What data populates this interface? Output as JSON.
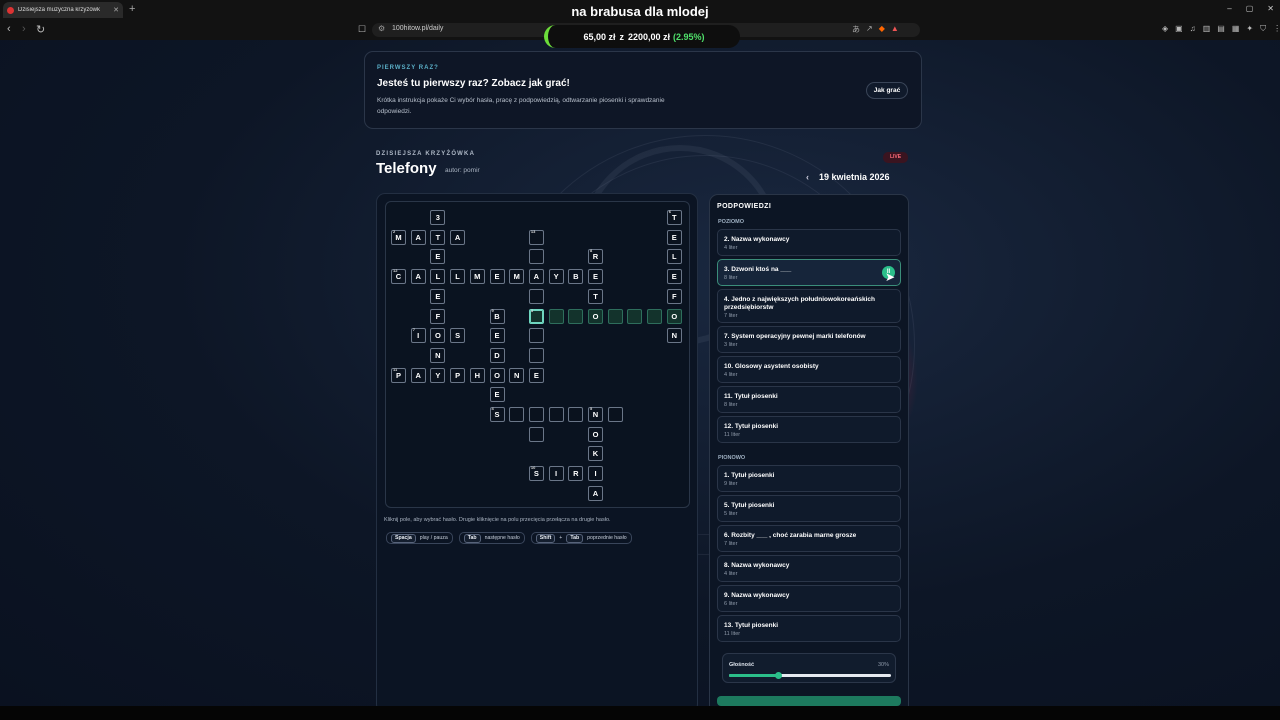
{
  "browser": {
    "tab_title": "Dzisiejsza muzyczna krzyżówk",
    "window_title": "na brabusa dla mlodej",
    "url": "100hitow.pl/daily",
    "new_tab": "+",
    "win_min": "–",
    "win_max": "▢",
    "win_close": "✕",
    "back": "‹",
    "forward": "›",
    "reload": "↻"
  },
  "donation": {
    "amount": "65,00 zł",
    "sep": "z",
    "goal": "2200,00 zł",
    "percent": "(2.95%)",
    "progress": 0.0295
  },
  "intro": {
    "eyebrow": "PIERWSZY RAZ?",
    "heading": "Jesteś tu pierwszy raz? Zobacz jak grać!",
    "body": "Krótka instrukcja pokaże Ci wybór hasła, pracę z podpowiedzią, odtwarzanie piosenki i sprawdzanie odpowiedzi.",
    "button": "Jak grać"
  },
  "crossword": {
    "eyebrow": "DZISIEJSZA KRZYŻÓWKA",
    "title": "Telefony",
    "author": "autor: pomir",
    "live": "LIVE",
    "date": "19 kwietnia 2026",
    "hint": "Kliknij pole, aby wybrać hasło. Drugie kliknięcie na polu przecięcia przełącza na drugie hasło.",
    "keys": [
      {
        "key1": "Spacja",
        "label": "play / pauza"
      },
      {
        "key1": "Tab",
        "label": "następne hasło"
      },
      {
        "key1": "Shift",
        "plus": "+",
        "key2": "Tab",
        "label": "poprzednie hasło"
      }
    ]
  },
  "clues": {
    "header": "PODPOWIEDZI",
    "across_label": "POZIOMO",
    "down_label": "PIONOWO",
    "across": [
      {
        "title": "2. Nazwa wykonawcy",
        "len": "4 liter"
      },
      {
        "title": "3. Dzwoni ktoś na ___",
        "len": "8 liter",
        "active": true,
        "play": "II"
      },
      {
        "title": "4. Jedno z największych południowokoreańskich",
        "title2": "przedsiębiorstw",
        "len": "7 liter"
      },
      {
        "title": "7. System operacyjny pewnej marki telefonów",
        "len": "3 liter"
      },
      {
        "title": "10. Glosowy asystent osobisty",
        "len": "4 liter"
      },
      {
        "title": "11. Tytuł piosenki",
        "len": "8 liter"
      },
      {
        "title": "12. Tytuł piosenki",
        "len": "11 liter"
      }
    ],
    "down": [
      {
        "title": "1. Tytuł piosenki",
        "len": "9 liter"
      },
      {
        "title": "5. Tytuł piosenki",
        "len": "5 liter"
      },
      {
        "title": "6. Rozbity ___ , choć zarabia marne grosze",
        "len": "7 liter"
      },
      {
        "title": "8. Nazwa wykonawcy",
        "len": "4 liter"
      },
      {
        "title": "9. Nazwa wykonawcy",
        "len": "6 liter"
      },
      {
        "title": "13. Tytuł piosenki",
        "len": "11 liter"
      }
    ]
  },
  "volume": {
    "label": "Głośność",
    "value": "30%",
    "level": 0.3
  },
  "colors": {
    "accent": "#2bbf8a",
    "live": "#ff6b7a",
    "donation_green": "#4fe06a"
  },
  "grid_cells": [
    {
      "r": 0,
      "c": 2,
      "ch": "3"
    },
    {
      "r": 0,
      "c": 14,
      "ch": "T",
      "n": "6"
    },
    {
      "r": 1,
      "c": 0,
      "ch": "M",
      "n": "2"
    },
    {
      "r": 1,
      "c": 1,
      "ch": "A"
    },
    {
      "r": 1,
      "c": 2,
      "ch": "T"
    },
    {
      "r": 1,
      "c": 3,
      "ch": "A"
    },
    {
      "r": 1,
      "c": 7,
      "ch": "",
      "n": "13"
    },
    {
      "r": 1,
      "c": 14,
      "ch": "E"
    },
    {
      "r": 2,
      "c": 2,
      "ch": "E"
    },
    {
      "r": 2,
      "c": 7,
      "ch": ""
    },
    {
      "r": 2,
      "c": 10,
      "ch": "R",
      "n": "8"
    },
    {
      "r": 2,
      "c": 14,
      "ch": "L"
    },
    {
      "r": 3,
      "c": 0,
      "ch": "C",
      "n": "12"
    },
    {
      "r": 3,
      "c": 1,
      "ch": "A"
    },
    {
      "r": 3,
      "c": 2,
      "ch": "L"
    },
    {
      "r": 3,
      "c": 3,
      "ch": "L"
    },
    {
      "r": 3,
      "c": 4,
      "ch": "M"
    },
    {
      "r": 3,
      "c": 5,
      "ch": "E"
    },
    {
      "r": 3,
      "c": 6,
      "ch": "M"
    },
    {
      "r": 3,
      "c": 7,
      "ch": "A"
    },
    {
      "r": 3,
      "c": 8,
      "ch": "Y"
    },
    {
      "r": 3,
      "c": 9,
      "ch": "B"
    },
    {
      "r": 3,
      "c": 10,
      "ch": "E"
    },
    {
      "r": 3,
      "c": 14,
      "ch": "E"
    },
    {
      "r": 4,
      "c": 2,
      "ch": "E"
    },
    {
      "r": 4,
      "c": 7,
      "ch": ""
    },
    {
      "r": 4,
      "c": 10,
      "ch": "T"
    },
    {
      "r": 4,
      "c": 14,
      "ch": "F"
    },
    {
      "r": 5,
      "c": 2,
      "ch": "F"
    },
    {
      "r": 5,
      "c": 5,
      "ch": "B",
      "n": "9"
    },
    {
      "r": 5,
      "c": 7,
      "ch": "",
      "n": "3",
      "act": true,
      "sel": true
    },
    {
      "r": 5,
      "c": 8,
      "ch": "",
      "act": true
    },
    {
      "r": 5,
      "c": 9,
      "ch": "",
      "act": true
    },
    {
      "r": 5,
      "c": 10,
      "ch": "O",
      "act": true
    },
    {
      "r": 5,
      "c": 11,
      "ch": "",
      "act": true
    },
    {
      "r": 5,
      "c": 12,
      "ch": "",
      "act": true
    },
    {
      "r": 5,
      "c": 13,
      "ch": "",
      "act": true
    },
    {
      "r": 5,
      "c": 14,
      "ch": "O",
      "act": true
    },
    {
      "r": 6,
      "c": 1,
      "ch": "I",
      "n": "7"
    },
    {
      "r": 6,
      "c": 2,
      "ch": "O"
    },
    {
      "r": 6,
      "c": 3,
      "ch": "S"
    },
    {
      "r": 6,
      "c": 5,
      "ch": "E"
    },
    {
      "r": 6,
      "c": 7,
      "ch": ""
    },
    {
      "r": 6,
      "c": 14,
      "ch": "N"
    },
    {
      "r": 7,
      "c": 2,
      "ch": "N"
    },
    {
      "r": 7,
      "c": 5,
      "ch": "D"
    },
    {
      "r": 7,
      "c": 7,
      "ch": ""
    },
    {
      "r": 8,
      "c": 0,
      "ch": "P",
      "n": "11"
    },
    {
      "r": 8,
      "c": 1,
      "ch": "A"
    },
    {
      "r": 8,
      "c": 2,
      "ch": "Y"
    },
    {
      "r": 8,
      "c": 3,
      "ch": "P"
    },
    {
      "r": 8,
      "c": 4,
      "ch": "H"
    },
    {
      "r": 8,
      "c": 5,
      "ch": "O"
    },
    {
      "r": 8,
      "c": 6,
      "ch": "N"
    },
    {
      "r": 8,
      "c": 7,
      "ch": "E"
    },
    {
      "r": 9,
      "c": 5,
      "ch": "E"
    },
    {
      "r": 10,
      "c": 5,
      "ch": "S",
      "n": "4"
    },
    {
      "r": 10,
      "c": 6,
      "ch": ""
    },
    {
      "r": 10,
      "c": 7,
      "ch": ""
    },
    {
      "r": 10,
      "c": 8,
      "ch": ""
    },
    {
      "r": 10,
      "c": 9,
      "ch": ""
    },
    {
      "r": 10,
      "c": 10,
      "ch": "N",
      "n": "5"
    },
    {
      "r": 10,
      "c": 11,
      "ch": ""
    },
    {
      "r": 11,
      "c": 7,
      "ch": ""
    },
    {
      "r": 11,
      "c": 10,
      "ch": "O"
    },
    {
      "r": 12,
      "c": 10,
      "ch": "K"
    },
    {
      "r": 13,
      "c": 7,
      "ch": "S",
      "n": "10"
    },
    {
      "r": 13,
      "c": 8,
      "ch": "I"
    },
    {
      "r": 13,
      "c": 9,
      "ch": "R"
    },
    {
      "r": 13,
      "c": 10,
      "ch": "I"
    },
    {
      "r": 14,
      "c": 10,
      "ch": "A"
    }
  ]
}
